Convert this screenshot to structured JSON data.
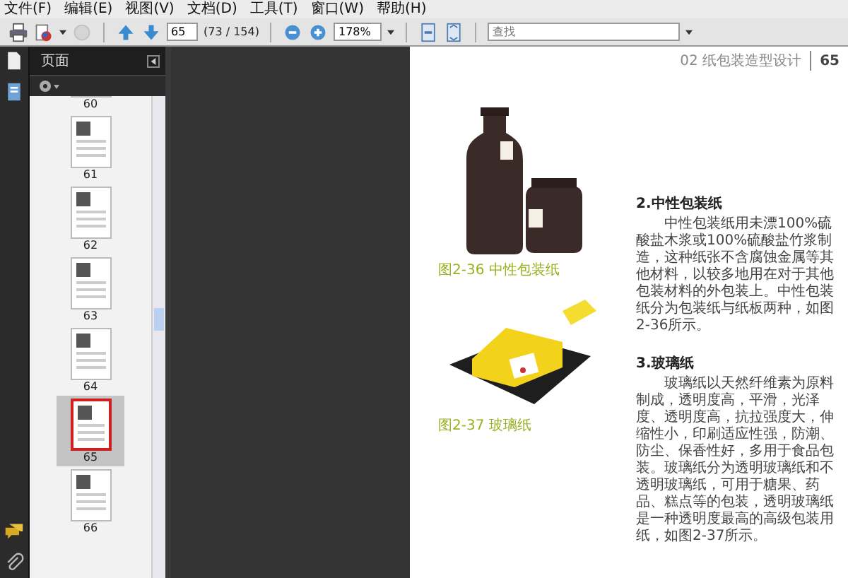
{
  "menu": [
    "文件(F)",
    "编辑(E)",
    "视图(V)",
    "文档(D)",
    "工具(T)",
    "窗口(W)",
    "帮助(H)"
  ],
  "toolbar": {
    "page_number": "65",
    "page_count": "(73 / 154)",
    "zoom": "178%",
    "search": {
      "placeholder": "查找"
    }
  },
  "pages_panel": {
    "title": "页面",
    "thumbnails": [
      {
        "label": "60",
        "selected": false
      },
      {
        "label": "61",
        "selected": false
      },
      {
        "label": "62",
        "selected": false
      },
      {
        "label": "63",
        "selected": false
      },
      {
        "label": "64",
        "selected": false
      },
      {
        "label": "65",
        "selected": true
      },
      {
        "label": "66",
        "selected": false
      }
    ]
  },
  "document": {
    "running_head": "02 纸包装造型设计",
    "page_number": "65",
    "figures": [
      {
        "kind": "bottles",
        "caption": "图2-36 中性包装纸"
      },
      {
        "kind": "cheese",
        "caption": "图2-37 玻璃纸"
      }
    ],
    "sections": [
      {
        "heading": "2.中性包装纸",
        "body": "中性包装纸用未漂100%硫酸盐木浆或100%硫酸盐竹浆制造，这种纸张不含腐蚀金属等其他材料，以较多地用在对于其他包装材料的外包装上。中性包装纸分为包装纸与纸板两种，如图2-36所示。"
      },
      {
        "heading": "3.玻璃纸",
        "body": "玻璃纸以天然纤维素为原料制成，透明度高，平滑，光泽度、透明度高，抗拉强度大，伸缩性小，印刷适应性强，防潮、防尘、保香性好，多用于食品包装。玻璃纸分为透明玻璃纸和不透明玻璃纸，可用于糖果、药品、糕点等的包装，透明玻璃纸是一种透明度最高的高级包装用纸，如图2-37所示。"
      }
    ]
  }
}
